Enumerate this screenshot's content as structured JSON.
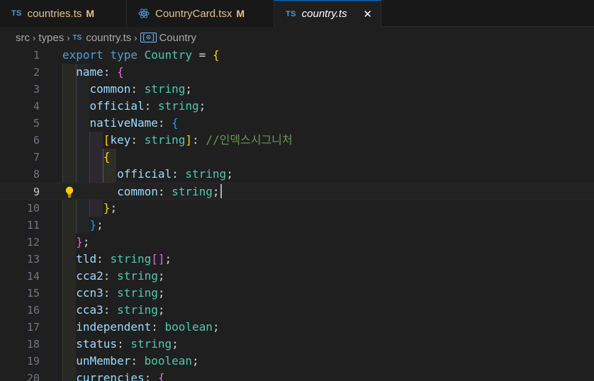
{
  "tabs": [
    {
      "type_icon": "TS",
      "name": "countries.ts",
      "badge": "M"
    },
    {
      "type_icon": "react-icon",
      "name": "CountryCard.tsx",
      "badge": "M"
    },
    {
      "type_icon": "TS",
      "name": "country.ts",
      "close": "✕"
    }
  ],
  "breadcrumb": {
    "items": [
      "src",
      "types",
      "country.ts",
      "Country"
    ],
    "separator": "›",
    "file_icon": "TS",
    "symbol_icon": "[⊙]"
  },
  "editor": {
    "current_line": 9,
    "lines": [
      {
        "n": "1",
        "tokens": [
          {
            "t": "export",
            "c": "k"
          },
          {
            "t": " ",
            "c": "o"
          },
          {
            "t": "type",
            "c": "k"
          },
          {
            "t": " ",
            "c": "o"
          },
          {
            "t": "Country",
            "c": "ty"
          },
          {
            "t": " = ",
            "c": "o"
          },
          {
            "t": "{",
            "c": "b1"
          }
        ]
      },
      {
        "n": "2",
        "tokens": [
          {
            "t": "  ",
            "c": "o"
          },
          {
            "t": "name",
            "c": "p"
          },
          {
            "t": ": ",
            "c": "o"
          },
          {
            "t": "{",
            "c": "b2"
          }
        ]
      },
      {
        "n": "3",
        "tokens": [
          {
            "t": "    ",
            "c": "o"
          },
          {
            "t": "common",
            "c": "p"
          },
          {
            "t": ": ",
            "c": "o"
          },
          {
            "t": "string",
            "c": "ty"
          },
          {
            "t": ";",
            "c": "o"
          }
        ]
      },
      {
        "n": "4",
        "tokens": [
          {
            "t": "    ",
            "c": "o"
          },
          {
            "t": "official",
            "c": "p"
          },
          {
            "t": ": ",
            "c": "o"
          },
          {
            "t": "string",
            "c": "ty"
          },
          {
            "t": ";",
            "c": "o"
          }
        ]
      },
      {
        "n": "5",
        "tokens": [
          {
            "t": "    ",
            "c": "o"
          },
          {
            "t": "nativeName",
            "c": "p"
          },
          {
            "t": ": ",
            "c": "o"
          },
          {
            "t": "{",
            "c": "b3"
          }
        ]
      },
      {
        "n": "6",
        "tokens": [
          {
            "t": "      ",
            "c": "o"
          },
          {
            "t": "[",
            "c": "b1"
          },
          {
            "t": "key",
            "c": "p"
          },
          {
            "t": ": ",
            "c": "o"
          },
          {
            "t": "string",
            "c": "ty"
          },
          {
            "t": "]",
            "c": "b1"
          },
          {
            "t": ": ",
            "c": "o"
          },
          {
            "t": "//인덱스시그니처",
            "c": "cm"
          }
        ]
      },
      {
        "n": "7",
        "tokens": [
          {
            "t": "      ",
            "c": "o"
          },
          {
            "t": "{",
            "c": "b1"
          }
        ]
      },
      {
        "n": "8",
        "tokens": [
          {
            "t": "        ",
            "c": "o"
          },
          {
            "t": "official",
            "c": "p"
          },
          {
            "t": ": ",
            "c": "o"
          },
          {
            "t": "string",
            "c": "ty"
          },
          {
            "t": ";",
            "c": "o"
          }
        ]
      },
      {
        "n": "9",
        "tokens": [
          {
            "t": "        ",
            "c": "o"
          },
          {
            "t": "common",
            "c": "p"
          },
          {
            "t": ": ",
            "c": "o"
          },
          {
            "t": "string",
            "c": "ty"
          },
          {
            "t": ";",
            "c": "o"
          }
        ]
      },
      {
        "n": "10",
        "tokens": [
          {
            "t": "      ",
            "c": "o"
          },
          {
            "t": "}",
            "c": "b1"
          },
          {
            "t": ";",
            "c": "o"
          }
        ]
      },
      {
        "n": "11",
        "tokens": [
          {
            "t": "    ",
            "c": "o"
          },
          {
            "t": "}",
            "c": "b3"
          },
          {
            "t": ";",
            "c": "o"
          }
        ]
      },
      {
        "n": "12",
        "tokens": [
          {
            "t": "  ",
            "c": "o"
          },
          {
            "t": "}",
            "c": "b2"
          },
          {
            "t": ";",
            "c": "o"
          }
        ]
      },
      {
        "n": "13",
        "tokens": [
          {
            "t": "  ",
            "c": "o"
          },
          {
            "t": "tld",
            "c": "p"
          },
          {
            "t": ": ",
            "c": "o"
          },
          {
            "t": "string",
            "c": "ty"
          },
          {
            "t": "[]",
            "c": "b2"
          },
          {
            "t": ";",
            "c": "o"
          }
        ]
      },
      {
        "n": "14",
        "tokens": [
          {
            "t": "  ",
            "c": "o"
          },
          {
            "t": "cca2",
            "c": "p"
          },
          {
            "t": ": ",
            "c": "o"
          },
          {
            "t": "string",
            "c": "ty"
          },
          {
            "t": ";",
            "c": "o"
          }
        ]
      },
      {
        "n": "15",
        "tokens": [
          {
            "t": "  ",
            "c": "o"
          },
          {
            "t": "ccn3",
            "c": "p"
          },
          {
            "t": ": ",
            "c": "o"
          },
          {
            "t": "string",
            "c": "ty"
          },
          {
            "t": ";",
            "c": "o"
          }
        ]
      },
      {
        "n": "16",
        "tokens": [
          {
            "t": "  ",
            "c": "o"
          },
          {
            "t": "cca3",
            "c": "p"
          },
          {
            "t": ": ",
            "c": "o"
          },
          {
            "t": "string",
            "c": "ty"
          },
          {
            "t": ";",
            "c": "o"
          }
        ]
      },
      {
        "n": "17",
        "tokens": [
          {
            "t": "  ",
            "c": "o"
          },
          {
            "t": "independent",
            "c": "p"
          },
          {
            "t": ": ",
            "c": "o"
          },
          {
            "t": "boolean",
            "c": "ty"
          },
          {
            "t": ";",
            "c": "o"
          }
        ]
      },
      {
        "n": "18",
        "tokens": [
          {
            "t": "  ",
            "c": "o"
          },
          {
            "t": "status",
            "c": "p"
          },
          {
            "t": ": ",
            "c": "o"
          },
          {
            "t": "string",
            "c": "ty"
          },
          {
            "t": ";",
            "c": "o"
          }
        ]
      },
      {
        "n": "19",
        "tokens": [
          {
            "t": "  ",
            "c": "o"
          },
          {
            "t": "unMember",
            "c": "p"
          },
          {
            "t": ": ",
            "c": "o"
          },
          {
            "t": "boolean",
            "c": "ty"
          },
          {
            "t": ";",
            "c": "o"
          }
        ]
      },
      {
        "n": "20",
        "tokens": [
          {
            "t": "  ",
            "c": "o"
          },
          {
            "t": "currencies",
            "c": "p"
          },
          {
            "t": ": ",
            "c": "o"
          },
          {
            "t": "{",
            "c": "b2"
          }
        ]
      }
    ]
  }
}
